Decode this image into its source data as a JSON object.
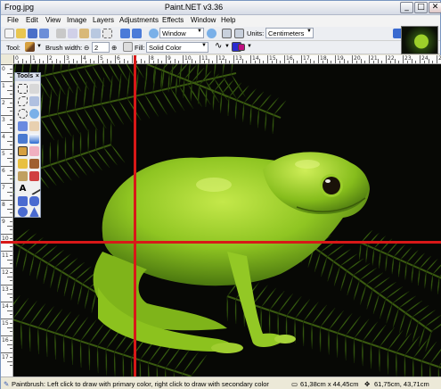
{
  "window": {
    "file_name": "Frog.jpg",
    "app_title": "Paint.NET v3.36",
    "minimize": "_",
    "maximize": "□",
    "close": "✕"
  },
  "menu": [
    "File",
    "Edit",
    "View",
    "Image",
    "Layers",
    "Adjustments",
    "Effects",
    "Window",
    "Help"
  ],
  "toolbar1": {
    "window_label": "Window",
    "units_label": "Units:",
    "units_value": "Centimeters"
  },
  "toolbar2": {
    "tool_label": "Tool:",
    "brush_width_label": "Brush width:",
    "brush_width_value": "2",
    "fill_label": "Fill:",
    "fill_value": "Solid Color"
  },
  "tools_palette": {
    "title": "Tools",
    "close": "×"
  },
  "status": {
    "hint": "Paintbrush: Left click to draw with primary color, right click to draw with secondary color",
    "image_size": "61,38cm x 44,45cm",
    "cursor_position": "61,75cm, 43,71cm"
  },
  "rulers": {
    "top": [
      "0",
      "1",
      "2",
      "3",
      "4",
      "5",
      "6",
      "7",
      "8",
      "9",
      "10",
      "11",
      "12",
      "13",
      "14",
      "15",
      "16",
      "17",
      "18",
      "19",
      "20",
      "21",
      "22",
      "23",
      "24",
      "25"
    ],
    "left": [
      "0",
      "1",
      "2",
      "3",
      "4",
      "5",
      "6",
      "7",
      "8",
      "9",
      "10",
      "11",
      "12",
      "13",
      "14",
      "15",
      "16",
      "17"
    ]
  },
  "colors": {
    "guide": "#d81818",
    "primary": "#2a2ad0",
    "secondary": "#c01080"
  }
}
